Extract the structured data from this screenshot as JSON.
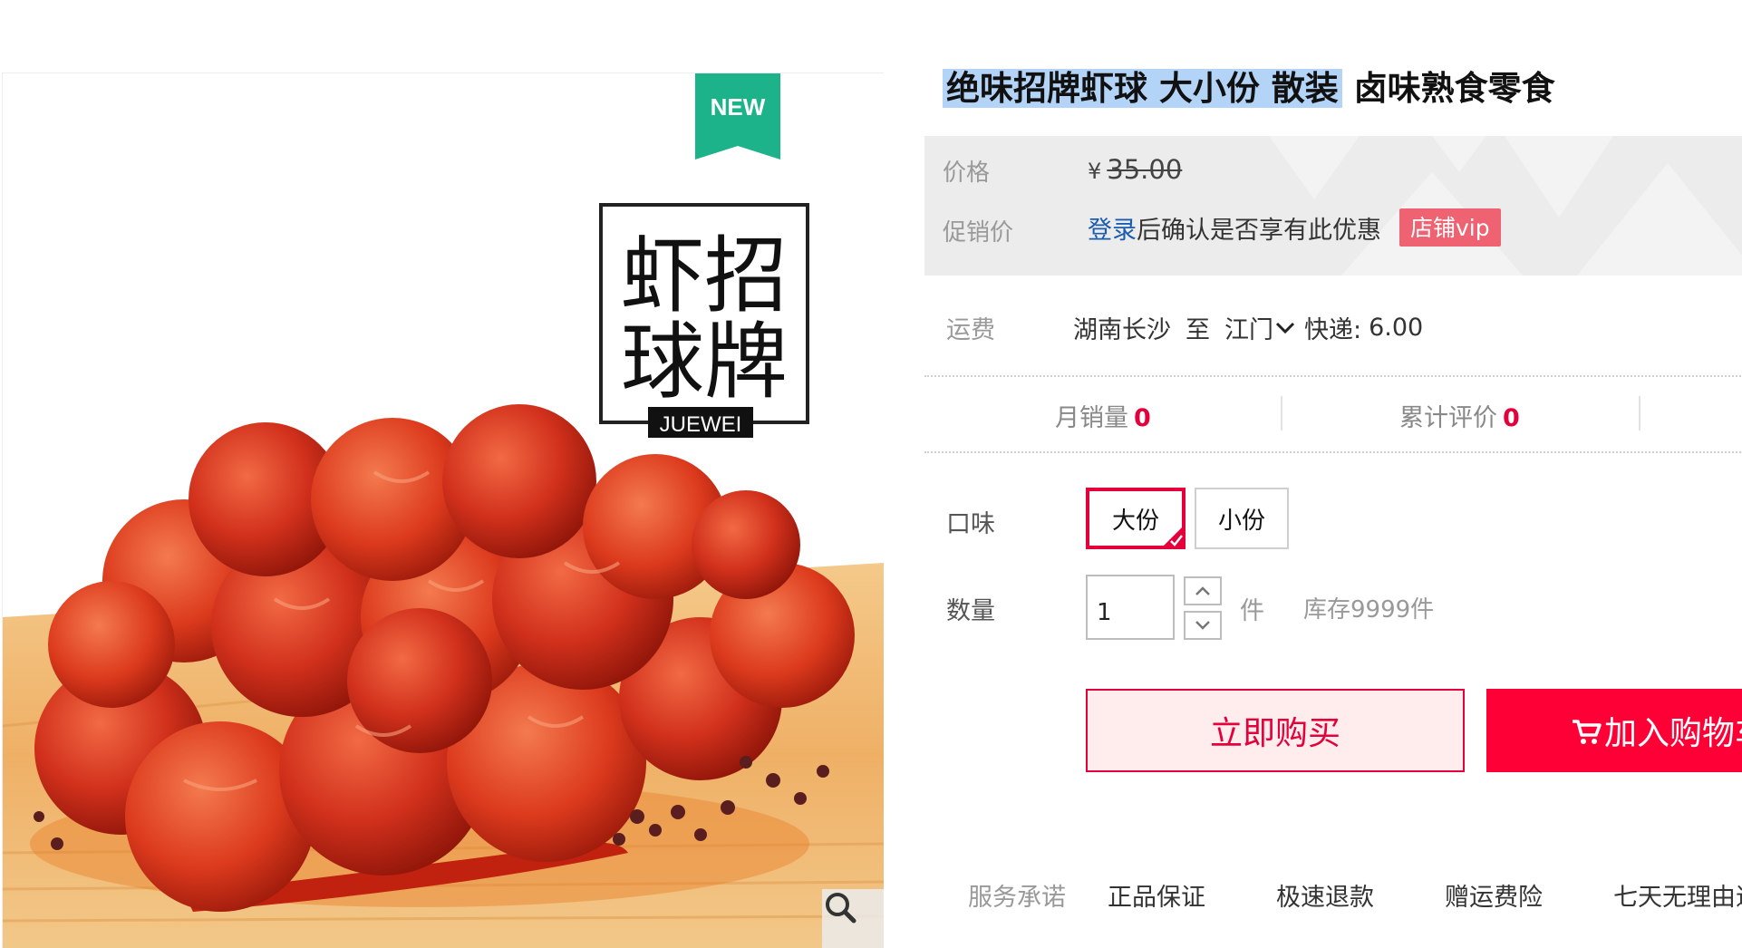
{
  "product": {
    "title_highlighted": "绝味招牌虾球 大小份 散装",
    "title_rest": "卤味熟食零食",
    "image_badge": "NEW",
    "image_logo_text": [
      "虾招",
      "球牌"
    ],
    "image_logo_brand": "JUEWEI"
  },
  "price": {
    "label": "价格",
    "currency": "¥",
    "value": "35.00",
    "promo_label": "促销价",
    "login_link": "登录",
    "promo_text": "后确认是否享有此优惠",
    "vip_badge": "店铺vip"
  },
  "shipping": {
    "label": "运费",
    "origin": "湖南长沙",
    "to": "至",
    "destination": "江门",
    "method": "快递:",
    "cost": "6.00"
  },
  "stats": {
    "monthly_sales_label": "月销量",
    "monthly_sales": "0",
    "reviews_label": "累计评价",
    "reviews": "0"
  },
  "options": {
    "flavor_label": "口味",
    "flavors": [
      {
        "label": "大份",
        "selected": true
      },
      {
        "label": "小份",
        "selected": false
      }
    ],
    "quantity_label": "数量",
    "quantity": "1",
    "unit": "件",
    "stock": "库存9999件"
  },
  "actions": {
    "buy_now": "立即购买",
    "add_to_cart": "加入购物车"
  },
  "service": {
    "label": "服务承诺",
    "items": [
      "正品保证",
      "极速退款",
      "赠运费险",
      "七天无理由退换"
    ]
  },
  "colors": {
    "accent": "#e4003a",
    "cart_button": "#ff0036",
    "link": "#1a5cb0",
    "vip": "#ee6272",
    "badge_green": "#1db38a"
  }
}
